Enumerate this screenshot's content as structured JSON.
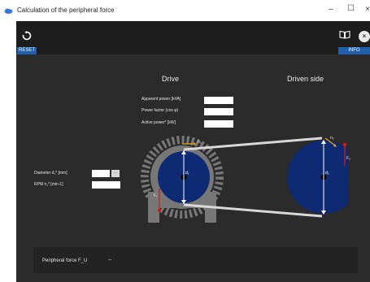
{
  "window": {
    "title": "Calculation of the peripheral force",
    "minimize_glyph": "–",
    "maximize_glyph": "☐",
    "close_glyph": "×",
    "app_icon": "cloud-icon"
  },
  "toolbar": {
    "reset_label": "RESET",
    "reset_icon": "reset-icon",
    "book_icon": "book-icon",
    "info_label": "INFO",
    "info_icon": "close-circle-icon",
    "info_icon_glyph": "×",
    "accent_color": "#1f5fae"
  },
  "drive": {
    "heading": "Drive",
    "fields": [
      {
        "label": "Apparent power [kVA]",
        "value": ""
      },
      {
        "label": "Power factor (cos φ)",
        "value": ""
      },
      {
        "label": "Active power* [kW]",
        "value": ""
      }
    ]
  },
  "driven": {
    "heading": "Driven side"
  },
  "inputs": {
    "diameter_label": "Diameter d₁* [mm]",
    "diameter_value": "",
    "diameter_button": "...",
    "rpm_label": "RPM n₁* [min-1]",
    "rpm_value": ""
  },
  "diagram": {
    "drive_diameter_label": "d₁",
    "driven_diameter_label": "d₂",
    "drive_speed_label": "n₁",
    "driven_speed_label": "n₂",
    "drive_force_label": "F₁",
    "driven_force_label": "F₂",
    "pulley_color": "#0d2a73",
    "housing_color": "#777777",
    "belt_color": "#d8d8d8",
    "speed_arrow_color": "#e8a020",
    "force_arrow_color": "#cc1f1f"
  },
  "result": {
    "label": "Peripheral force F_U",
    "value": "--"
  }
}
